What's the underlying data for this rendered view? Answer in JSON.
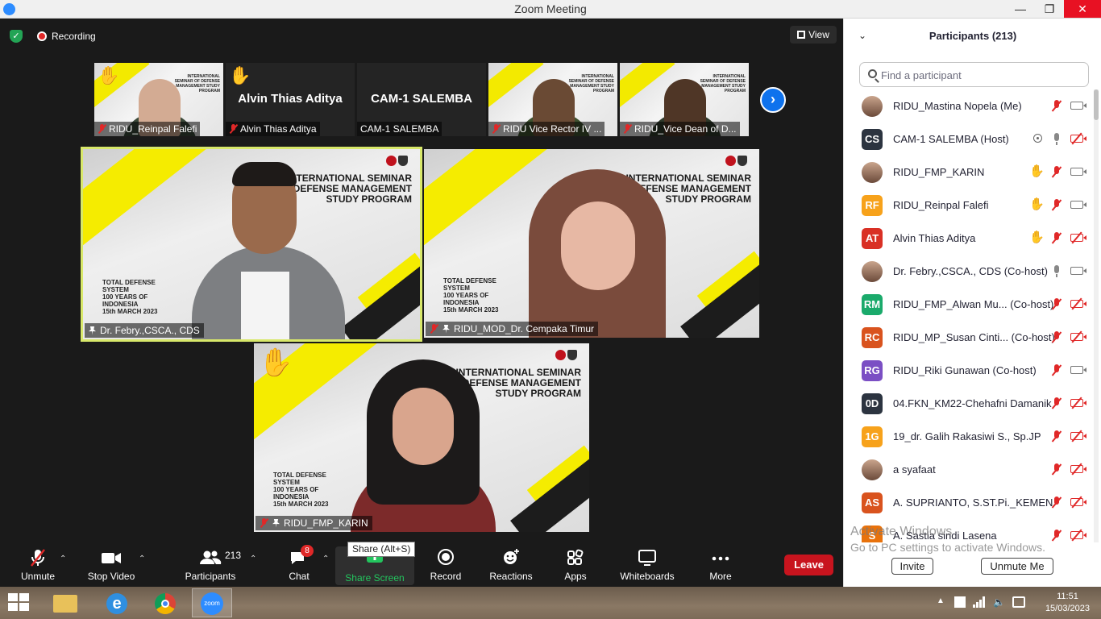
{
  "window": {
    "title": "Zoom Meeting"
  },
  "top_bar": {
    "recording_label": "Recording",
    "view_label": "View"
  },
  "thumbnails": [
    {
      "name": "RIDU_Reinpal Falefi",
      "has_video": true,
      "hand_raised": true
    },
    {
      "name": "Alvin Thias Aditya",
      "big_name": "Alvin Thias Aditya",
      "has_video": false,
      "hand_raised": true
    },
    {
      "name": "CAM-1 SALEMBA",
      "big_name": "CAM-1 SALEMBA",
      "has_video": false,
      "hand_raised": false
    },
    {
      "name": "RIDU Vice Rector IV ...",
      "has_video": true,
      "hand_raised": false
    },
    {
      "name": "RIDU_Vice Dean of D...",
      "has_video": true,
      "hand_raised": false
    }
  ],
  "thumb_banner": "INTERNATIONAL SEMINAR OF DEFENSE MANAGEMENT STUDY PROGRAM",
  "tiles": [
    {
      "name": "Dr. Febry.,CSCA., CDS",
      "active": true,
      "muted": false,
      "hand_raised": false
    },
    {
      "name": "RIDU_MOD_Dr. Cempaka Timur",
      "active": false,
      "muted": true,
      "hand_raised": false
    },
    {
      "name": "RIDU_FMP_KARIN",
      "active": false,
      "muted": true,
      "hand_raised": true
    }
  ],
  "banner": {
    "title": "INTERNATIONAL SEMINAR OF DEFENSE MANAGEMENT STUDY PROGRAM",
    "sub1": "TOTAL DEFENSE SYSTEM",
    "sub2": "100 YEARS OF INDONESIA",
    "sub3": "15th MARCH 2023"
  },
  "toolbar": {
    "unmute": "Unmute",
    "stop_video": "Stop Video",
    "participants": "Participants",
    "participants_count": "213",
    "chat": "Chat",
    "chat_badge": "8",
    "share_screen": "Share Screen",
    "record": "Record",
    "reactions": "Reactions",
    "apps": "Apps",
    "whiteboards": "Whiteboards",
    "more": "More",
    "leave": "Leave",
    "tooltip": "Share (Alt+S)"
  },
  "participants_panel": {
    "title": "Participants (213)",
    "search_placeholder": "Find a participant",
    "invite": "Invite",
    "unmute_me": "Unmute Me",
    "participants": [
      {
        "initials": "",
        "name": "RIDU_Mastina Nopela (Me)",
        "color": "",
        "photo": true,
        "hand": false,
        "mic": "off",
        "cam": "on",
        "dot": false
      },
      {
        "initials": "CS",
        "name": "CAM-1 SALEMBA (Host)",
        "color": "#2c3440",
        "photo": false,
        "hand": false,
        "mic": "on",
        "cam": "off",
        "dot": true
      },
      {
        "initials": "",
        "name": "RIDU_FMP_KARIN",
        "color": "",
        "photo": true,
        "hand": true,
        "mic": "off",
        "cam": "on",
        "dot": false
      },
      {
        "initials": "RF",
        "name": "RIDU_Reinpal Falefi",
        "color": "#f7a21b",
        "photo": false,
        "hand": true,
        "mic": "off",
        "cam": "on",
        "dot": false
      },
      {
        "initials": "AT",
        "name": "Alvin Thias Aditya",
        "color": "#d93025",
        "photo": false,
        "hand": true,
        "mic": "off",
        "cam": "off",
        "dot": false
      },
      {
        "initials": "",
        "name": "Dr. Febry.,CSCA., CDS (Co-host)",
        "color": "",
        "photo": true,
        "hand": false,
        "mic": "on",
        "cam": "on",
        "dot": false
      },
      {
        "initials": "RM",
        "name": "RIDU_FMP_Alwan Mu...  (Co-host)",
        "color": "#1aaa6b",
        "photo": false,
        "hand": false,
        "mic": "off",
        "cam": "off",
        "dot": false
      },
      {
        "initials": "RC",
        "name": "RIDU_MP_Susan Cinti...  (Co-host)",
        "color": "#d9531e",
        "photo": false,
        "hand": false,
        "mic": "off",
        "cam": "off",
        "dot": false
      },
      {
        "initials": "RG",
        "name": "RIDU_Riki Gunawan (Co-host)",
        "color": "#7b4fc4",
        "photo": false,
        "hand": false,
        "mic": "off",
        "cam": "on",
        "dot": false
      },
      {
        "initials": "0D",
        "name": "04.FKN_KM22-Chehafni Damanik",
        "color": "#2c3440",
        "photo": false,
        "hand": false,
        "mic": "off",
        "cam": "off",
        "dot": false
      },
      {
        "initials": "1G",
        "name": "19_dr. Galih Rakasiwi S., Sp.JP",
        "color": "#f7a21b",
        "photo": false,
        "hand": false,
        "mic": "off",
        "cam": "off",
        "dot": false
      },
      {
        "initials": "",
        "name": "a syafaat",
        "color": "",
        "photo": true,
        "hand": false,
        "mic": "off",
        "cam": "off",
        "dot": false
      },
      {
        "initials": "AS",
        "name": "A. SUPRIANTO, S.ST.Pi._KEMEN...",
        "color": "#d9531e",
        "photo": false,
        "hand": false,
        "mic": "off",
        "cam": "off",
        "dot": false
      },
      {
        "initials": "S",
        "name": "A. Sastia sindi Lasena",
        "color": "#e8720c",
        "photo": false,
        "hand": false,
        "mic": "off",
        "cam": "off",
        "dot": false
      }
    ]
  },
  "watermark": {
    "line1": "Activate Windows",
    "line2": "Go to PC settings to activate Windows."
  },
  "taskbar": {
    "time": "11:51",
    "date": "15/03/2023"
  }
}
